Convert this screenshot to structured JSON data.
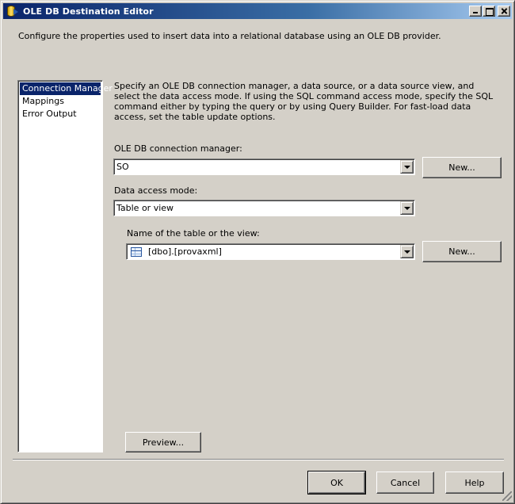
{
  "window": {
    "title": "OLE DB Destination Editor"
  },
  "header": {
    "description": "Configure the properties used to insert data into a relational database using an OLE DB provider."
  },
  "nav": {
    "items": [
      {
        "label": "Connection Manager",
        "selected": true
      },
      {
        "label": "Mappings",
        "selected": false
      },
      {
        "label": "Error Output",
        "selected": false
      }
    ]
  },
  "main": {
    "description": "Specify an OLE DB connection manager, a data source, or a data source view, and select the data access mode. If using the SQL command access mode, specify the SQL command either by typing the query or by using Query Builder. For fast-load data access, set the table update options.",
    "connection_manager": {
      "label": "OLE DB connection manager:",
      "value": "SO",
      "new_label": "New..."
    },
    "access_mode": {
      "label": "Data access mode:",
      "value": "Table or view"
    },
    "table": {
      "label": "Name of the table or the view:",
      "value": "[dbo].[provaxml]",
      "new_label": "New..."
    },
    "preview_label": "Preview..."
  },
  "footer": {
    "ok_label": "OK",
    "cancel_label": "Cancel",
    "help_label": "Help"
  }
}
